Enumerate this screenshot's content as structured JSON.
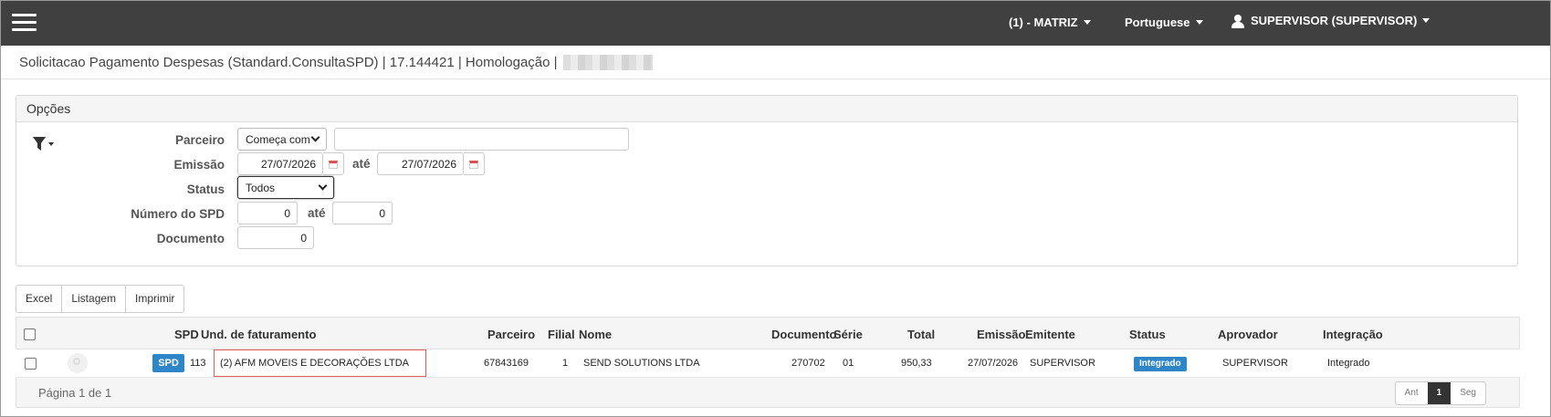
{
  "topbar": {
    "menu_icon": "hamburger-menu-icon",
    "company": "(1) - MATRIZ",
    "language": "Portuguese",
    "user": "SUPERVISOR (SUPERVISOR)",
    "user_icon": "user-icon"
  },
  "page": {
    "title": "Solicitacao Pagamento Despesas (Standard.ConsultaSPD) | 17.144421 | Homologação |"
  },
  "options": {
    "header": "Opções",
    "filter_icon": "filter-dropdown-icon",
    "parceiro_label": "Parceiro",
    "parceiro_mode": "Começa com",
    "parceiro_value": "",
    "emissao_label": "Emissão",
    "emissao_from": "27/07/2026",
    "ate_label": "até",
    "emissao_to": "27/07/2026",
    "status_label": "Status",
    "status_value": "Todos",
    "numero_label": "Número do SPD",
    "numero_from": "0",
    "numero_to": "0",
    "documento_label": "Documento",
    "documento_value": "0"
  },
  "actions": {
    "excel": "Excel",
    "listagem": "Listagem",
    "imprimir": "Imprimir"
  },
  "table": {
    "headers": {
      "spd": "SPD",
      "und": "Und. de faturamento",
      "parceiro": "Parceiro",
      "filial": "Filial",
      "nome": "Nome",
      "documento": "Documento",
      "serie": "Série",
      "total": "Total",
      "emissao": "Emissão",
      "emitente": "Emitente",
      "status": "Status",
      "aprovador": "Aprovador",
      "integracao": "Integração"
    },
    "row": {
      "badge": "SPD",
      "spd": "113",
      "und": "(2) AFM MOVEIS E DECORAÇÕES LTDA",
      "parceiro": "67843169",
      "filial": "1",
      "nome": "SEND SOLUTIONS LTDA",
      "documento": "270702",
      "serie": "01",
      "total": "950,33",
      "emissao": "27/07/2026",
      "emitente": "SUPERVISOR",
      "status": "Integrado",
      "aprovador": "SUPERVISOR",
      "integracao": "Integrado"
    }
  },
  "pagination": {
    "info": "Página 1 de 1",
    "prev": "Ant",
    "current": "1",
    "next": "Seg"
  },
  "colors": {
    "topbar": "#404040",
    "accent": "#2e86c9",
    "highlight": "#e25d5d"
  }
}
